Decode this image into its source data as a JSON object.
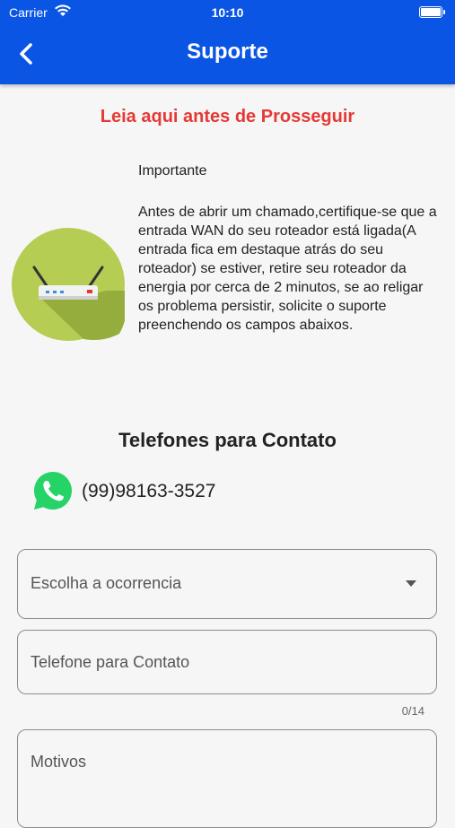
{
  "status_bar": {
    "carrier": "Carrier",
    "time": "10:10"
  },
  "header": {
    "title": "Suporte"
  },
  "notice": {
    "headline": "Leia aqui antes de Prosseguir",
    "important_title": "Importante",
    "important_text": "Antes de abrir um chamado,certifique-se que a entrada WAN do seu roteador está ligada(A entrada fica em destaque atrás do seu roteador) se estiver, retire seu roteador da energia por cerca de 2 minutos, se ao religar os problema persistir, solicite o suporte preenchendo os campos abaixos."
  },
  "contacts": {
    "title": "Telefones para Contato",
    "phone": "(99)98163-3527"
  },
  "form": {
    "occurrence_placeholder": "Escolha a ocorrencia",
    "phone_label": "Telefone para Contato",
    "phone_counter": "0/14",
    "reasons_label": "Motivos"
  },
  "colors": {
    "header_bg": "#0b55e5",
    "headline": "#e53935",
    "whatsapp": "#25d366",
    "router_circle": "#b5cd52"
  },
  "icons": {
    "back": "chevron-left-icon",
    "wifi": "wifi-icon",
    "battery": "battery-icon",
    "router": "router-icon",
    "whatsapp": "whatsapp-icon",
    "dropdown": "caret-down-icon"
  }
}
